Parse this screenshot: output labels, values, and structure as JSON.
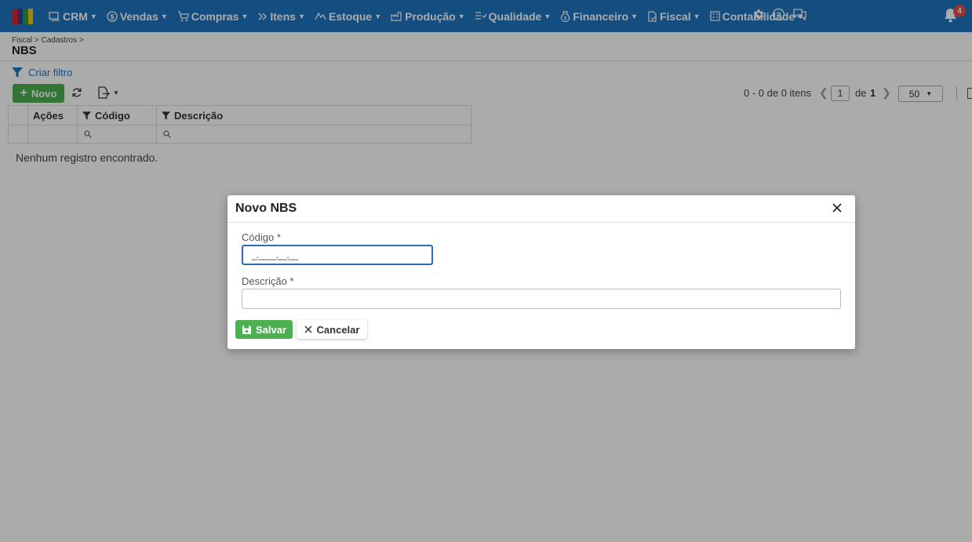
{
  "topbar": {
    "menu": [
      {
        "label": "CRM",
        "icon": "crm-icon"
      },
      {
        "label": "Vendas",
        "icon": "dollar-icon"
      },
      {
        "label": "Compras",
        "icon": "cart-icon"
      },
      {
        "label": "Itens",
        "icon": "items-icon"
      },
      {
        "label": "Estoque",
        "icon": "stock-icon"
      },
      {
        "label": "Produção",
        "icon": "factory-icon"
      },
      {
        "label": "Qualidade",
        "icon": "quality-icon"
      },
      {
        "label": "Financeiro",
        "icon": "money-bag-icon"
      },
      {
        "label": "Fiscal",
        "icon": "fiscal-icon"
      },
      {
        "label": "Contabilidade",
        "icon": "accounting-icon"
      }
    ],
    "notification_count": "4",
    "colors": {
      "bar": "#1f75c1",
      "badge": "#e24c4b"
    }
  },
  "page": {
    "breadcrumb": "Fiscal > Cadastros >",
    "title": "NBS",
    "filter_link": "Criar filtro"
  },
  "toolbar": {
    "new_label": "Novo",
    "pager_text": "0 - 0 de 0 itens",
    "page_current": "1",
    "page_of": "de",
    "page_total": "1",
    "page_size": "50"
  },
  "grid": {
    "columns": [
      "Ações",
      "Código",
      "Descrição"
    ],
    "empty_message": "Nenhum registro encontrado."
  },
  "modal": {
    "title": "Novo NBS",
    "fields": {
      "codigo_label": "Código *",
      "codigo_mask": "_.____.__.__",
      "descricao_label": "Descrição *",
      "descricao_value": ""
    },
    "save_label": "Salvar",
    "cancel_label": "Cancelar",
    "colors": {
      "save": "#4caf50",
      "focus": "#2d6cb5"
    }
  }
}
